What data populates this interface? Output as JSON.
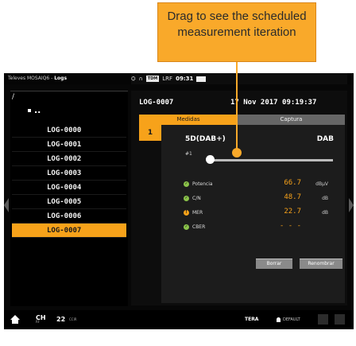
{
  "status_bar": {
    "app": "Televes MOSAIQ6",
    "section": "Logs",
    "indicators": [
      "TDM",
      "LRF"
    ],
    "clock": "09:31"
  },
  "left_panel": {
    "path": "/",
    "parent_dir": "..",
    "logs": [
      "LOG-0000",
      "LOG-0001",
      "LOG-0002",
      "LOG-0003",
      "LOG-0004",
      "LOG-0005",
      "LOG-0006",
      "LOG-0007"
    ],
    "selected_index": 7
  },
  "detail": {
    "filename": "LOG-0007",
    "date": "17 Nov 2017 09:19:37",
    "tabs": [
      "Medidas",
      "Captura"
    ],
    "active_tab": "Medidas",
    "row_number": "1",
    "service": "5D(DAB+)",
    "standard": "DAB",
    "iteration": "#1",
    "measurements": [
      {
        "name": "Potencia",
        "value": "66.7",
        "unit": "dBµV",
        "status": "ok",
        "color": "#8bc34a"
      },
      {
        "name": "C/N",
        "value": "48.7",
        "unit": "dB",
        "status": "ok",
        "color": "#8bc34a"
      },
      {
        "name": "MER",
        "value": "22.7",
        "unit": "dB",
        "status": "warning",
        "color": "#f7a21a"
      },
      {
        "name": "CBER",
        "value": "- - -",
        "unit": "",
        "status": "ok",
        "color": "#8bc34a"
      }
    ],
    "buttons": {
      "delete": "Borrar",
      "rename": "Renombrar"
    }
  },
  "bottom_bar": {
    "ch_label": "CH",
    "ch_sub": "RF",
    "channel": "22",
    "plan": "CCIR",
    "brand": "TERA",
    "profile": "DEFAULT"
  },
  "tooltip": {
    "text": "Drag to see the scheduled measurement iteration"
  },
  "colors": {
    "accent": "#f7a21a",
    "ok": "#8bc34a",
    "background": "#070707"
  }
}
